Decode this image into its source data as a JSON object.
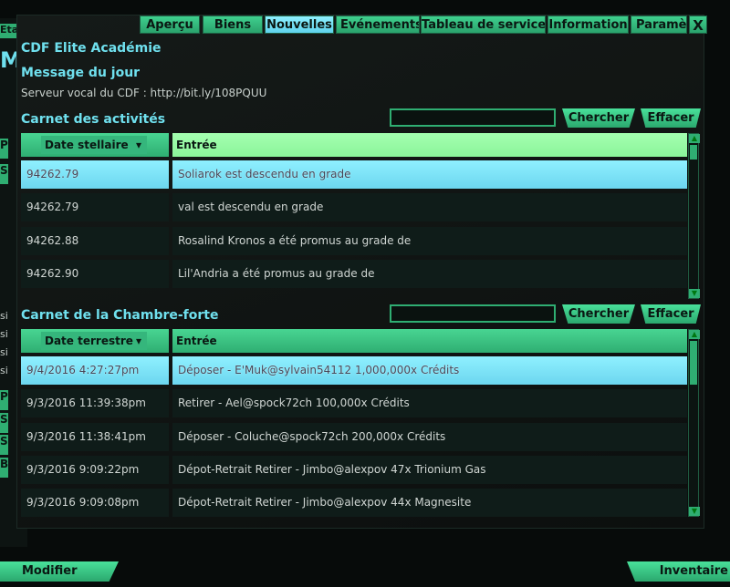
{
  "background": {
    "side_label": "Etat",
    "side_letters": [
      "M",
      "P",
      "S",
      "si",
      "si",
      "si",
      "si",
      "P",
      "S",
      "S",
      "B"
    ]
  },
  "tabs": [
    {
      "label": "Aperçu"
    },
    {
      "label": "Biens"
    },
    {
      "label": "Nouvelles",
      "active": true
    },
    {
      "label": "Evénements"
    },
    {
      "label": "Tableau de service"
    },
    {
      "label": "Information"
    },
    {
      "label": "Paramèt"
    }
  ],
  "close_label": "X",
  "fleet_name": "CDF Elite Académie",
  "motd": {
    "title": "Message du jour",
    "text": "Serveur vocal du CDF : http://bit.ly/108PQUU"
  },
  "activity": {
    "title": "Carnet des activités",
    "search_value": "",
    "search_label": "Chercher",
    "clear_label": "Effacer",
    "col_date": "Date stellaire",
    "col_entry": "Entrée",
    "rows": [
      {
        "date": "94262.79",
        "entry": "Soliarok est descendu en grade",
        "selected": true
      },
      {
        "date": "94262.79",
        "entry": "val est descendu en grade"
      },
      {
        "date": "94262.88",
        "entry": "Rosalind Kronos a été promus au grade de"
      },
      {
        "date": "94262.90",
        "entry": "Lil'Andria a été promus au grade de"
      }
    ]
  },
  "vault": {
    "title": "Carnet de la Chambre-forte",
    "search_value": "",
    "search_label": "Chercher",
    "clear_label": "Effacer",
    "col_date": "Date terrestre",
    "col_entry": "Entrée",
    "rows": [
      {
        "date": "9/4/2016 4:27:27pm",
        "entry": "Déposer - E'Muk@sylvain54112 1,000,000x Crédits",
        "selected": true
      },
      {
        "date": "9/3/2016 11:39:38pm",
        "entry": "Retirer - Ael@spock72ch 100,000x Crédits"
      },
      {
        "date": "9/3/2016 11:38:41pm",
        "entry": "Déposer - Coluche@spock72ch 200,000x Crédits"
      },
      {
        "date": "9/3/2016 9:09:22pm",
        "entry": "Dépot-Retrait Retirer - Jimbo@alexpov 47x Trionium Gas"
      },
      {
        "date": "9/3/2016 9:09:08pm",
        "entry": "Dépot-Retrait Retirer - Jimbo@alexpov 44x Magnesite"
      }
    ]
  },
  "bottom": {
    "modify_label": "Modifier",
    "inventory_label": "Inventaire"
  }
}
